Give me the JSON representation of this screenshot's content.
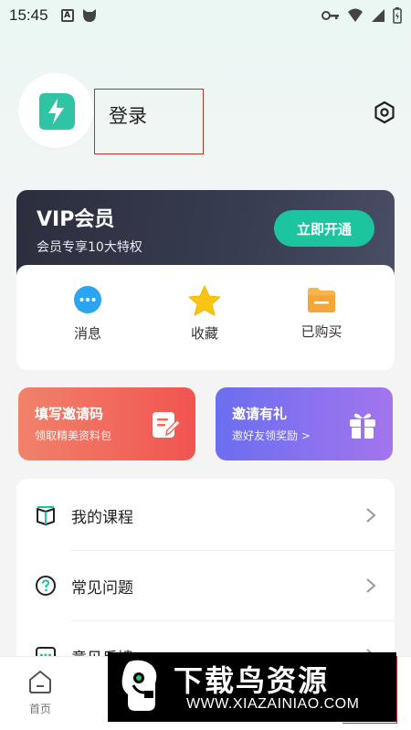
{
  "status_bar": {
    "time": "15:45",
    "a_icon_label": "A"
  },
  "profile": {
    "login_label": "登录"
  },
  "vip": {
    "title": "VIP会员",
    "subtitle": "会员专享10大特权",
    "button_label": "立即开通"
  },
  "quick_actions": [
    {
      "label": "消息"
    },
    {
      "label": "收藏"
    },
    {
      "label": "已购买"
    }
  ],
  "promos": {
    "invite_code": {
      "title": "填写邀请码",
      "subtitle": "领取精美资料包"
    },
    "gift": {
      "title": "邀请有礼",
      "subtitle": "邀好友领奖励 >"
    }
  },
  "menu": [
    {
      "label": "我的课程"
    },
    {
      "label": "常见问题"
    },
    {
      "label": "意见反馈"
    }
  ],
  "tabbar": {
    "home_label": "首页"
  },
  "watermark": {
    "title": "下载鸟资源",
    "url": "WWW.XIAZAINIAO.COM"
  },
  "colors": {
    "accent": "#1dc4a0",
    "vip_bg": "#2f3345",
    "invite": "#f25451",
    "gift": "#8f72ee"
  }
}
